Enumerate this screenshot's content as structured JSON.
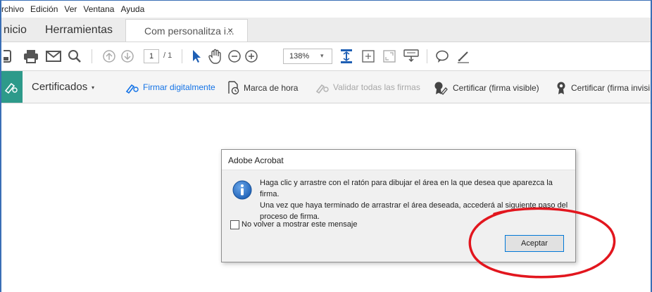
{
  "menu": [
    "rchivo",
    "Edición",
    "Ver",
    "Ventana",
    "Ayuda"
  ],
  "tabs": {
    "home": "nicio",
    "tools": "Herramientas",
    "document": "Com personalitza i...",
    "close": "×"
  },
  "toolbar": {
    "page_current": "1",
    "page_total": "/ 1",
    "zoom": "138%",
    "zoom_caret": "▾"
  },
  "certificates": {
    "title": "Certificados",
    "caret": "▾",
    "sign": "Firmar digitalmente",
    "timestamp": "Marca de hora",
    "validate": "Validar todas las firmas",
    "certify_visible": "Certificar (firma visible)",
    "certify_invisible": "Certificar (firma invisi"
  },
  "dialog": {
    "title": "Adobe Acrobat",
    "message_lines": [
      "Haga clic y arrastre con el ratón para dibujar el área en la que desea que aparezca la firma.",
      "Una vez que haya terminado de arrastrar el área deseada, accederá al siguiente paso del",
      "proceso de firma."
    ],
    "checkbox_label": "No volver a mostrar este mensaje",
    "ok_button": "Aceptar"
  },
  "colors": {
    "accent_teal": "#2d9a8a",
    "link_blue": "#1473e6",
    "annotation_red": "#e2161e",
    "frame_blue": "#3a6fb6"
  }
}
